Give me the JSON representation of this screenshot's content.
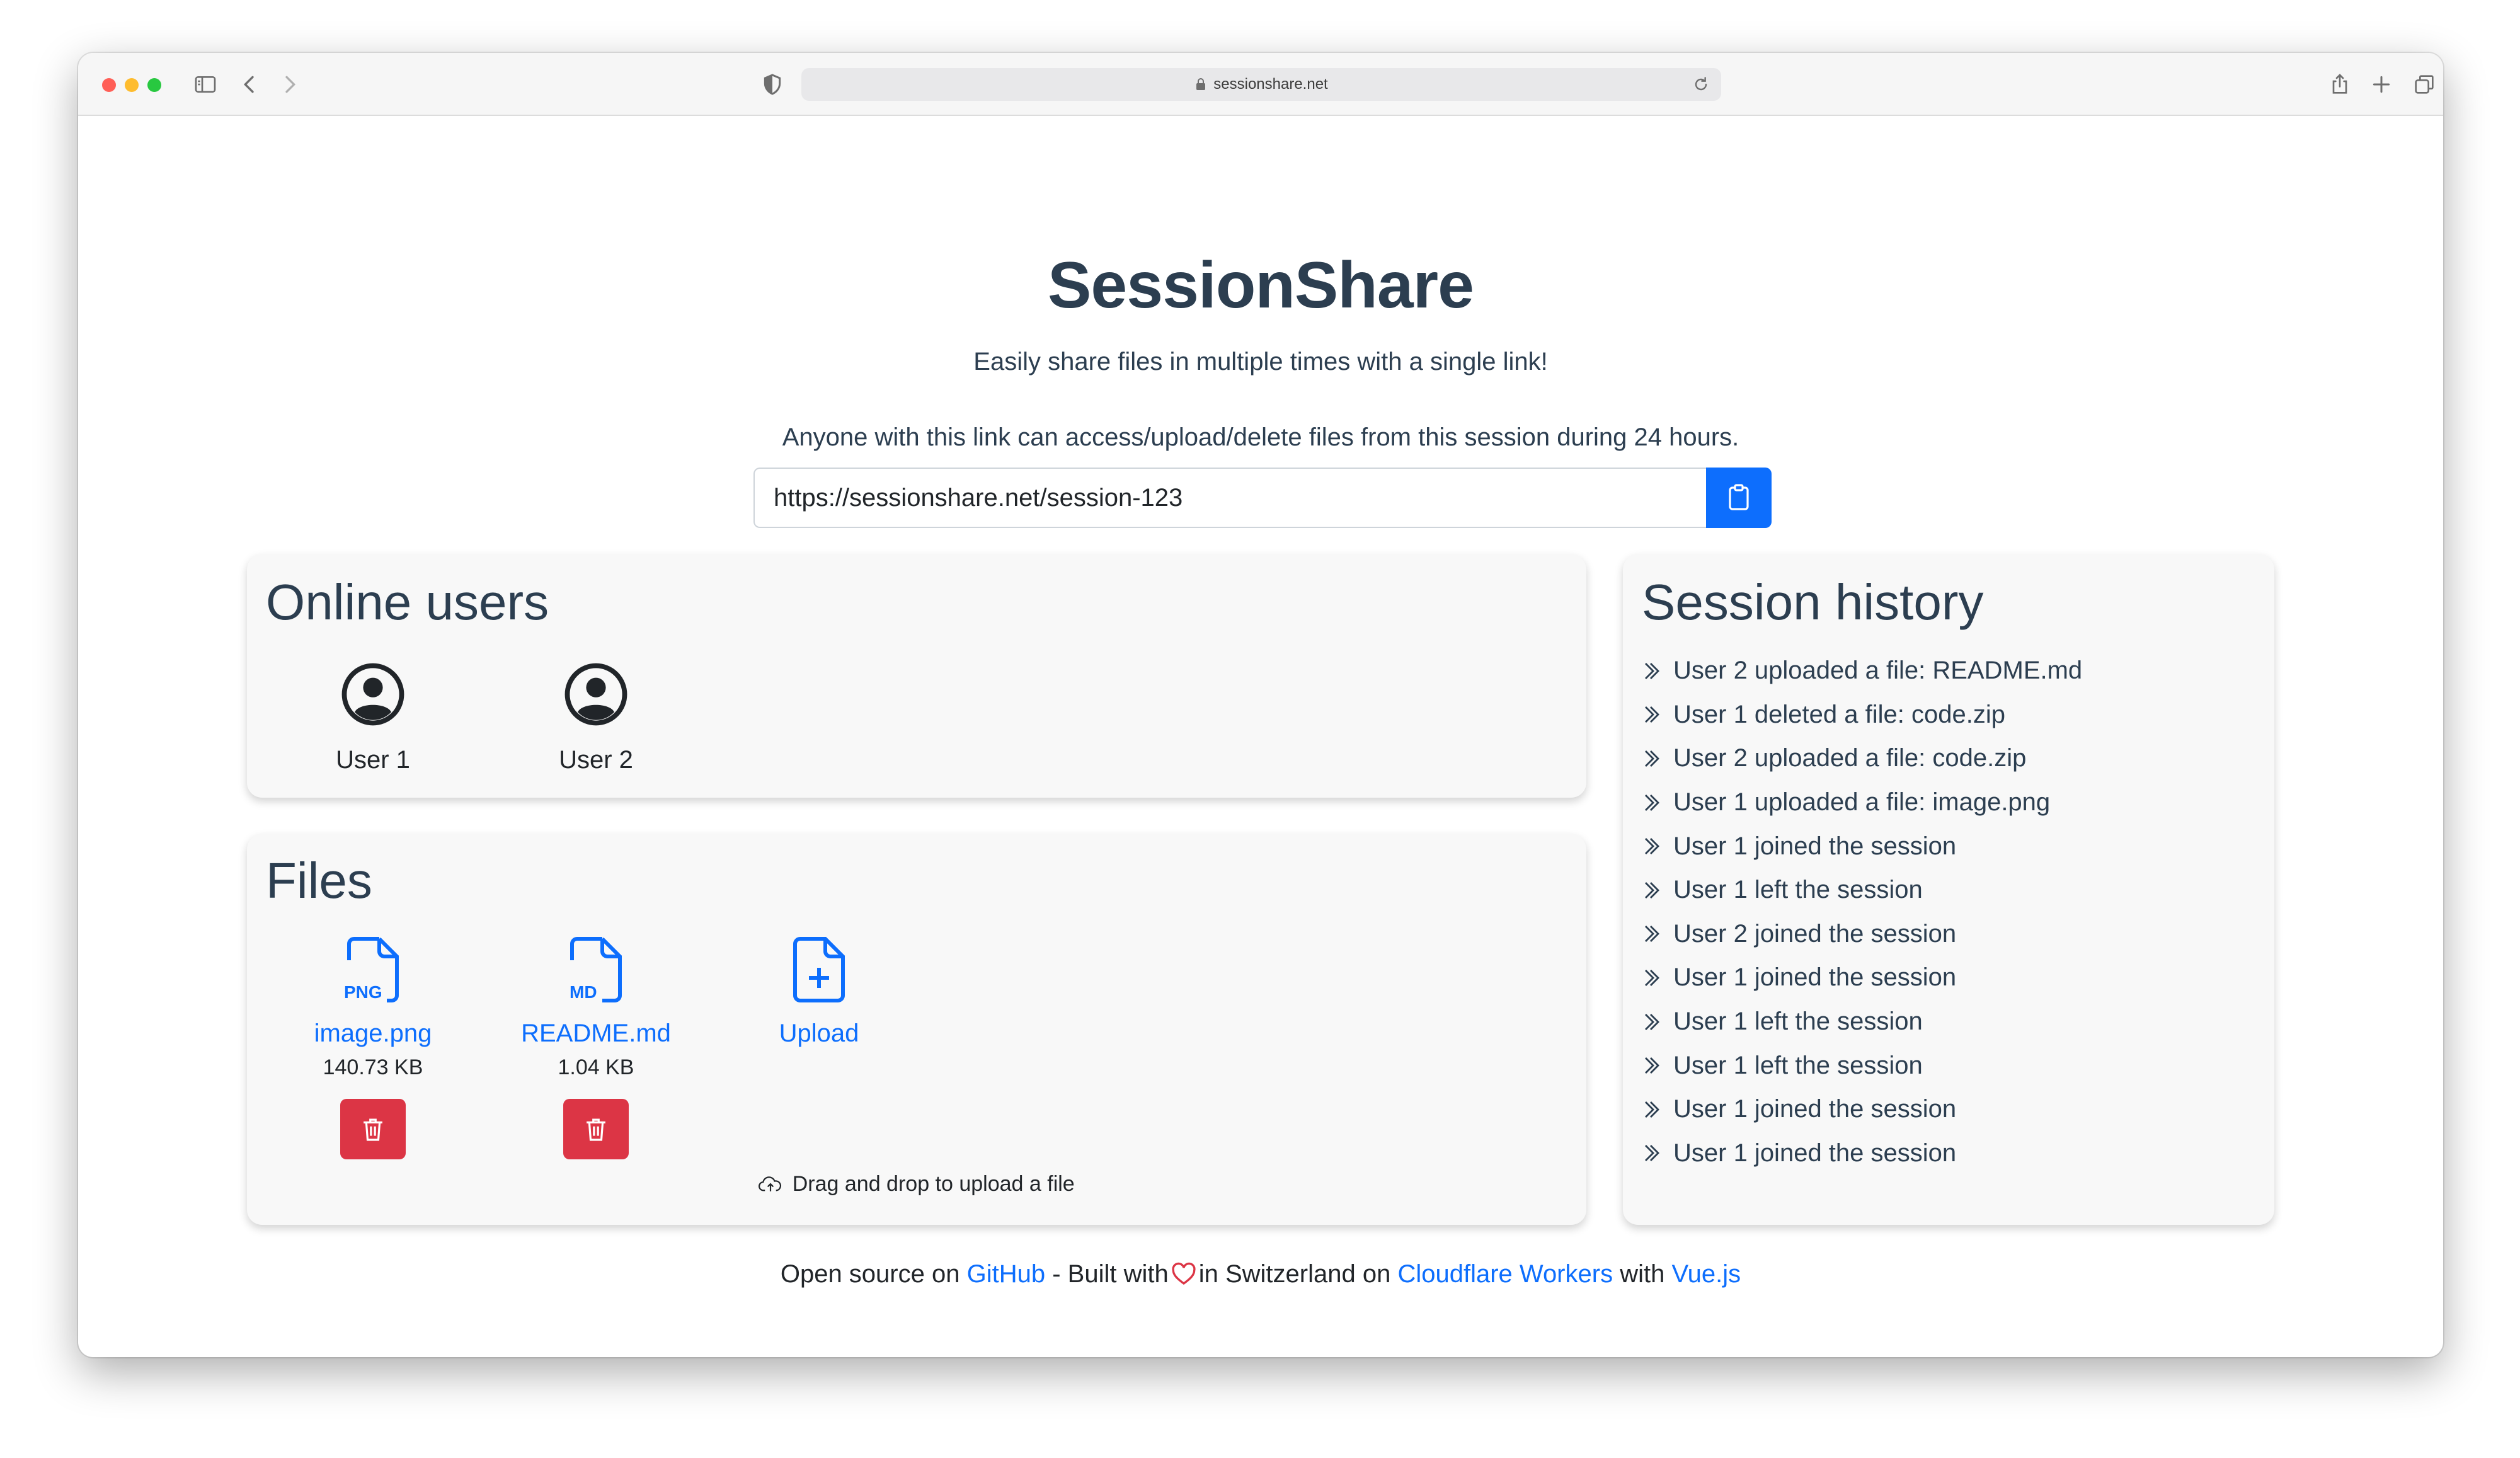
{
  "browser": {
    "url": "sessionshare.net"
  },
  "header": {
    "title": "SessionShare",
    "subtitle": "Easily share files in multiple times with a single link!",
    "notice": "Anyone with this link can access/upload/delete files from this session during 24 hours.",
    "session_link": "https://sessionshare.net/session-123"
  },
  "online_users": {
    "title": "Online users",
    "users": [
      {
        "name": "User 1",
        "icon": "user-circle-icon"
      },
      {
        "name": "User 2",
        "icon": "user-circle-icon"
      }
    ]
  },
  "files": {
    "title": "Files",
    "items": [
      {
        "name": "image.png",
        "type_label": "PNG",
        "size": "140.73 KB",
        "icon": "png-file-icon"
      },
      {
        "name": "README.md",
        "type_label": "MD",
        "size": "1.04 KB",
        "icon": "md-file-icon"
      }
    ],
    "upload_label": "Upload",
    "drag_hint": "Drag and drop to upload a file"
  },
  "session_history": {
    "title": "Session history",
    "entries": [
      "User 2 uploaded a file: README.md",
      "User 1 deleted a file: code.zip",
      "User 2 uploaded a file: code.zip",
      "User 1 uploaded a file: image.png",
      "User 1 joined the session",
      "User 1 left the session",
      "User 2 joined the session",
      "User 1 joined the session",
      "User 1 left the session",
      "User 1 left the session",
      "User 1 joined the session",
      "User 1 joined the session"
    ]
  },
  "footer": {
    "prefix": "Open source on",
    "github": "GitHub",
    "built_with": "- Built with",
    "in_switzerland": "in Switzerland on",
    "cloudflare": "Cloudflare Workers",
    "with": "with",
    "vue": "Vue.js"
  },
  "colors": {
    "primary": "#0d6efd",
    "danger": "#dc3545",
    "heading": "#2c3e50",
    "card_bg": "#f8f8f8"
  }
}
